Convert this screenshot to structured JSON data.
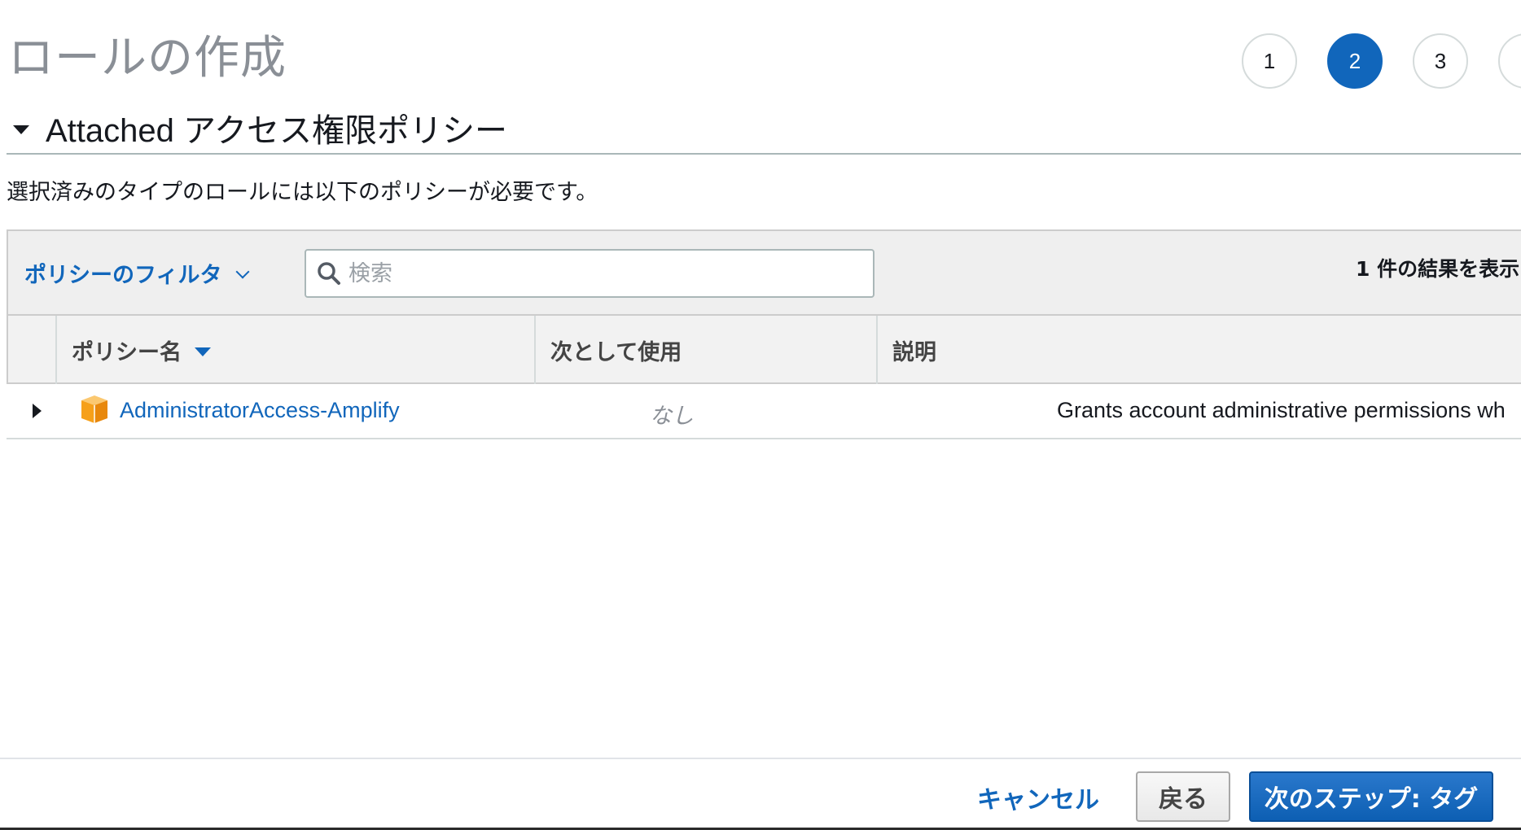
{
  "page": {
    "title": "ロールの作成"
  },
  "steps": [
    {
      "label": "1",
      "active": false
    },
    {
      "label": "2",
      "active": true
    },
    {
      "label": "3",
      "active": false
    },
    {
      "label": "",
      "active": false
    }
  ],
  "section": {
    "title": "Attached アクセス権限ポリシー",
    "description": "選択済みのタイプのロールには以下のポリシーが必要です。"
  },
  "toolbar": {
    "filter_label": "ポリシーのフィルタ",
    "search_placeholder": "検索",
    "results_count": "1 件の結果を表示"
  },
  "table": {
    "columns": {
      "name": "ポリシー名",
      "used_as": "次として使用",
      "description": "説明"
    },
    "rows": [
      {
        "name": "AdministratorAccess-Amplify",
        "used_as": "なし",
        "description": "Grants account administrative permissions wh"
      }
    ]
  },
  "footer": {
    "cancel_label": "キャンセル",
    "back_label": "戻る",
    "next_label": "次のステップ: タグ"
  },
  "colors": {
    "accent": "#1166bb",
    "aws_orange": "#f6a01a"
  },
  "icons": {
    "search": "search-icon",
    "policy": "aws-cube-icon",
    "section_collapse": "caret-down-icon",
    "row_expand": "caret-right-icon"
  }
}
